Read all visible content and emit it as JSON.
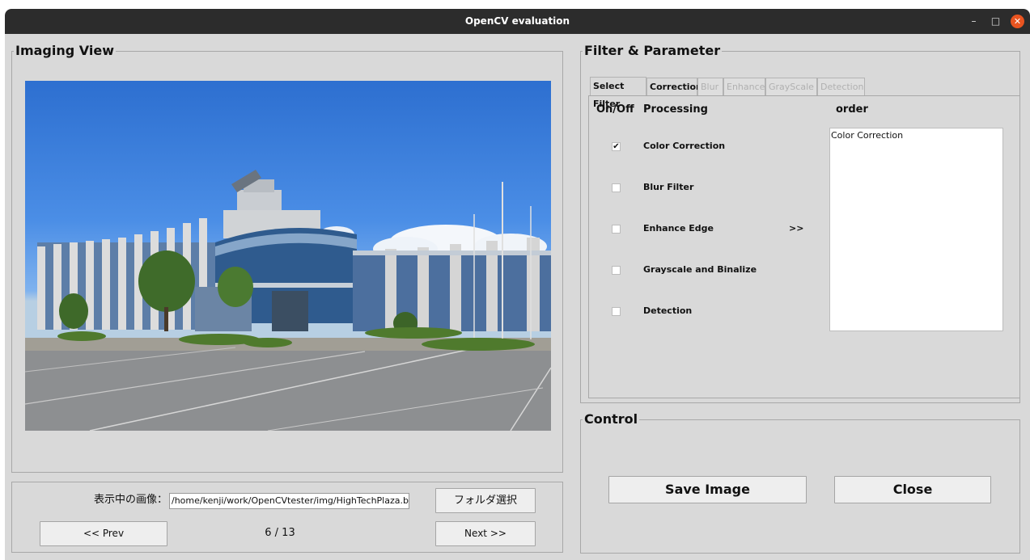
{
  "window": {
    "title": "OpenCV evaluation",
    "min_glyph": "–",
    "max_glyph": "□",
    "close_glyph": "✕"
  },
  "imaging": {
    "group_title": "Imaging View"
  },
  "nav": {
    "label": "表示中の画像：",
    "path": "/home/kenji/work/OpenCVtester/img/HighTechPlaza.bmp",
    "folder_button": "フォルダ選択",
    "prev_button": "<< Prev",
    "counter": "6 / 13",
    "next_button": "Next >>"
  },
  "filter": {
    "group_title": "Filter & Parameter",
    "tabs": [
      {
        "label": "Select Filter",
        "state": "selected"
      },
      {
        "label": "Correction",
        "state": "enabled"
      },
      {
        "label": "Blur",
        "state": "disabled"
      },
      {
        "label": "Enhance",
        "state": "disabled"
      },
      {
        "label": "GrayScale",
        "state": "disabled"
      },
      {
        "label": "Detection",
        "state": "disabled"
      }
    ],
    "headers": {
      "onoff": "On/Off",
      "processing": "Processing",
      "order": "order"
    },
    "processes": [
      {
        "label": "Color Correction",
        "checked": true
      },
      {
        "label": "Blur Filter",
        "checked": false
      },
      {
        "label": "Enhance Edge",
        "checked": false
      },
      {
        "label": "Grayscale and Binalize",
        "checked": false
      },
      {
        "label": "Detection",
        "checked": false
      }
    ],
    "arrow_label": ">>",
    "order_items": [
      "Color Correction"
    ],
    "check_glyph": "✔"
  },
  "control": {
    "group_title": "Control",
    "save_button": "Save Image",
    "close_button": "Close"
  },
  "colors": {
    "titlebar": "#2c2c2c",
    "close_accent": "#e95420",
    "window_bg": "#d9d9d9"
  }
}
